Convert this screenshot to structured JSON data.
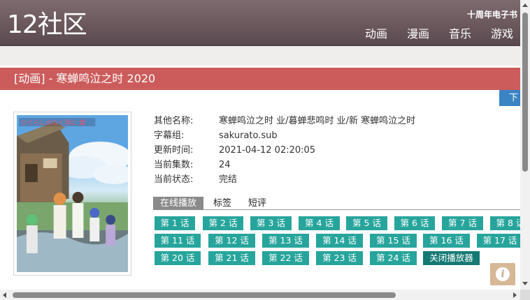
{
  "site": {
    "logo": "12社区",
    "ebook_link": "十周年电子书",
    "nav": [
      "动画",
      "漫画",
      "音乐",
      "游戏"
    ]
  },
  "page": {
    "title": "[动画] - 寒蝉鸣泣之时 2020",
    "download_button": "下"
  },
  "details": {
    "rows": [
      {
        "label": "其他名称:",
        "value": "寒蝉鸣泣之时 业/暮蝉悲鸣时 业/新 寒蝉鸣泣之时"
      },
      {
        "label": "字幕组:",
        "value": "sakurato.sub"
      },
      {
        "label": "更新时间:",
        "value": "2021-04-12 02:20:05"
      },
      {
        "label": "当前集数:",
        "value": "24"
      },
      {
        "label": "当前状态:",
        "value": "完结"
      }
    ]
  },
  "tabs": [
    "在线播放",
    "标签",
    "短评"
  ],
  "episodes": [
    "第 1 话",
    "第 2 话",
    "第 3 话",
    "第 4 话",
    "第 5 话",
    "第 6 话",
    "第 7 话",
    "第 8 话",
    "第 11 话",
    "第 12 话",
    "第 13 话",
    "第 14 话",
    "第 15 话",
    "第 16 话",
    "第 17 话",
    "第 20 话",
    "第 21 话",
    "第 22 话",
    "第 23 话",
    "第 24 话"
  ],
  "close_player": "关闭播放器",
  "info_icon_glyph": "i",
  "colors": {
    "header": "#6a585d",
    "title_bar": "#cc5c5c",
    "episode_button": "#27a59c",
    "close_button": "#167a74",
    "download_button": "#3b84c4"
  }
}
